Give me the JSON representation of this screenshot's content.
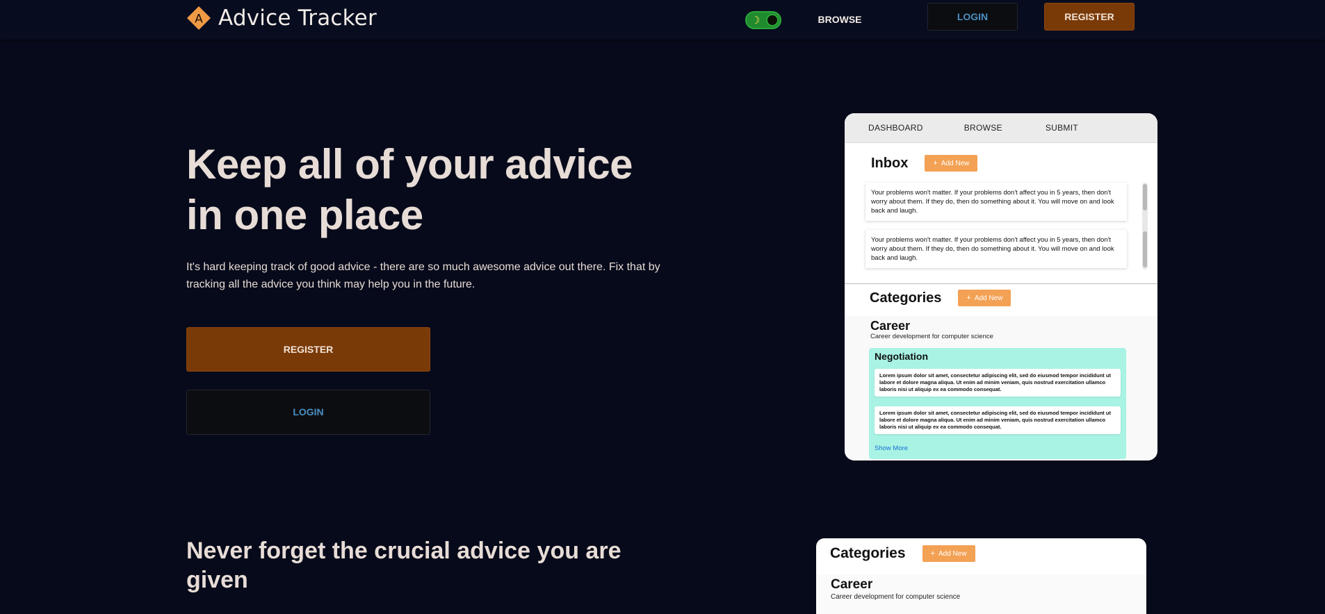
{
  "header": {
    "brand_letter": "A",
    "brand_title": "Advice Tracker",
    "theme_toggle_icon": "moon-icon",
    "nav_browse": "BROWSE",
    "login_label": "LOGIN",
    "register_label": "REGISTER"
  },
  "hero": {
    "title": "Keep all of your advice in one place",
    "description": "It's hard keeping track of good advice - there are so much awesome advice out there. Fix that by tracking all the advice you think may help you in the future.",
    "register_label": "REGISTER",
    "login_label": "LOGIN"
  },
  "section2": {
    "title": "Never forget the crucial advice you are given"
  },
  "preview": {
    "nav": [
      "DASHBOARD",
      "BROWSE",
      "SUBMIT"
    ],
    "inbox_title": "Inbox",
    "add_new": "Add New",
    "inbox_items": [
      "Your problems won't matter. If your problems don't affect you in 5 years, then don't worry about them. If they do, then do something about it. You will move on and look back and laugh.",
      "Your problems won't matter. If your problems don't affect you in 5 years, then don't worry about them. If they do, then do something about it. You will move on and look back and laugh."
    ],
    "categories_title": "Categories",
    "category": {
      "name": "Career",
      "description": "Career development for computer science"
    },
    "subcategory": {
      "name": "Negotiation",
      "items": [
        "Lorem ipsum dolor sit amet, consectetur adipiscing elit, sed do eiusmod tempor incididunt ut labore et dolore magna aliqua. Ut enim ad minim veniam, quis nostrud exercitation ullamco laboris nisi ut aliquip ex ea commodo consequat.",
        "Lorem ipsum dolor sit amet, consectetur adipiscing elit, sed do eiusmod tempor incididunt ut labore et dolore magna aliqua. Ut enim ad minim veniam, quis nostrud exercitation ullamco laboris nisi ut aliquip ex ea commodo consequat."
      ],
      "show_more": "Show More"
    }
  },
  "preview2": {
    "categories_title": "Categories",
    "add_new": "Add New",
    "category": {
      "name": "Career",
      "description": "Career development for computer science"
    }
  },
  "colors": {
    "background": "#070a1a",
    "accent_orange": "#7a3a08",
    "add_button": "#f3a154",
    "link_blue": "#4a8fc1",
    "subcategory_bg": "#a8f3e4"
  }
}
